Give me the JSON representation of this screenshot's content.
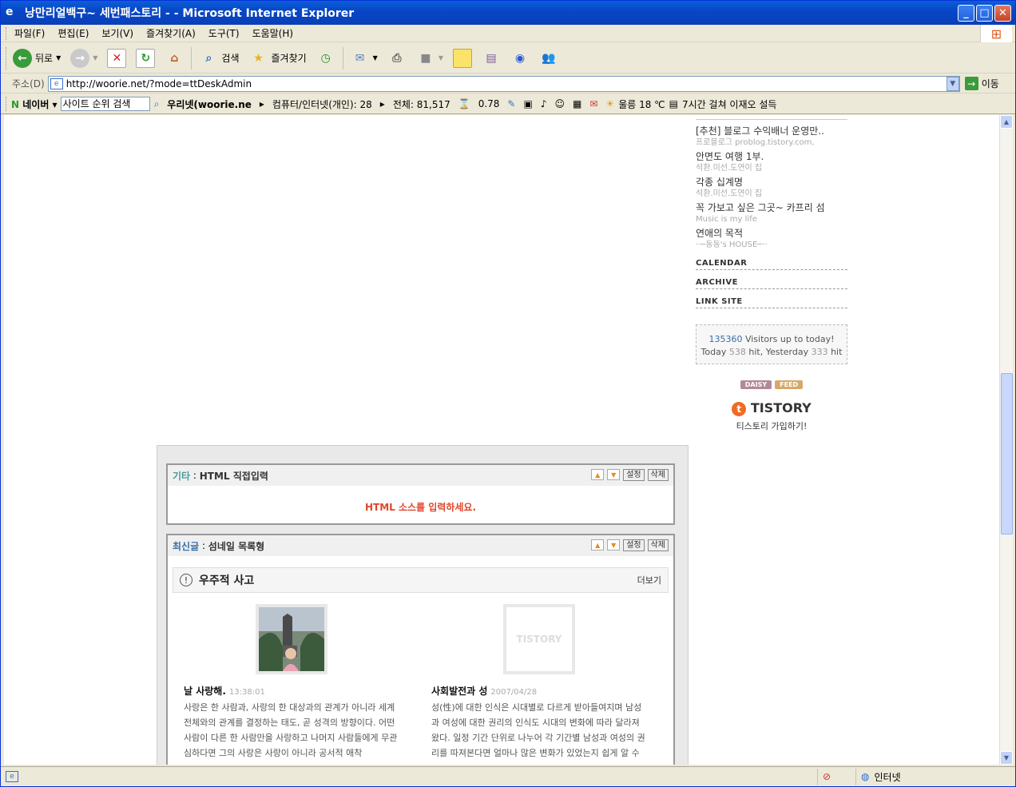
{
  "window": {
    "title": "낭만리얼백구~ 세번패스토리 - - Microsoft Internet Explorer"
  },
  "menu": [
    "파일(F)",
    "편집(E)",
    "보기(V)",
    "즐겨찾기(A)",
    "도구(T)",
    "도움말(H)"
  ],
  "toolbar": {
    "back": "뒤로",
    "search": "검색",
    "favorites": "즐겨찾기"
  },
  "address": {
    "label": "주소(D)",
    "url": "http://woorie.net/?mode=ttDeskAdmin",
    "go": "이동"
  },
  "naver": {
    "brand": "네이버",
    "search_value": "사이트 순위 검색",
    "site": "우리넷(woorie.ne",
    "category": "컴퓨터/인터넷(개인): 28",
    "total": "전체: 81,517",
    "ratio": "0.78",
    "weather": "울릉 18 ℃",
    "news": "7시간 걸쳐 이재오 설득"
  },
  "sidebar": {
    "posts": [
      {
        "title": "[추천] 블로그 수익배너 운영만..",
        "sub": "프로블로그 problog.tistory.com,"
      },
      {
        "title": "안면도 여행 1부.",
        "sub": "석환.미선.도연이 집"
      },
      {
        "title": "각종 십계명",
        "sub": "석환.미선.도연이 집"
      },
      {
        "title": "꼭 가보고 싶은 그곳~ 카프리 섬",
        "sub": "Music is my life"
      },
      {
        "title": "연애의 목적",
        "sub": "··─동동's HOUSE─··"
      }
    ],
    "sections": [
      "CALENDAR",
      "ARCHIVE",
      "LINK SITE"
    ],
    "visitor": {
      "total": "135360",
      "total_suffix": " Visitors up to today!",
      "today_prefix": "Today ",
      "today": "538",
      "yesterday_prefix": " hit, Yesterday ",
      "yesterday": "333",
      "hit_suffix": " hit"
    },
    "badges": [
      "DAISY",
      "FEED"
    ],
    "tistory_logo": "TISTORY",
    "tistory_join": "티스토리 가입하기!"
  },
  "widgets": {
    "etc": {
      "category": "기타",
      "name": "HTML 직접입력",
      "prompt": "HTML 소스를 입력하세요."
    },
    "recent": {
      "category": "최신글",
      "name": "섬네일 목록형"
    },
    "settings": "설정",
    "delete": "삭제"
  },
  "recent_block": {
    "title": "우주적 사고",
    "more": "더보기"
  },
  "posts": [
    {
      "title": "날 사랑해.",
      "time": "13:38:01",
      "body": "사랑은 한 사람과, 사랑의 한 대상과의 관계가 아니라 세계 전체와의 관계를 결정하는 태도, 곧 성격의 방향이다. 어떤 사람이 다른 한 사람만을 사랑하고 나머지 사람들에게 무관심하다면 그의 사랑은 사랑이 아니라 공서적 애착"
    },
    {
      "title": "사회발전과 성",
      "time": "2007/04/28",
      "body": "성(性)에 대한 인식은 시대별로 다르게 받아들여지며 남성과 여성에 대한 권리의 인식도 시대의 변화에 따라 달라져왔다. 일정 기간 단위로 나누어 각 기간별 남성과 여성의 권리를 따져본다면 얼마나 많은 변화가 있었는지 쉽게 알 수"
    }
  ],
  "post_thumb2_logo": "TISTORY",
  "status": {
    "zone": "인터넷"
  }
}
